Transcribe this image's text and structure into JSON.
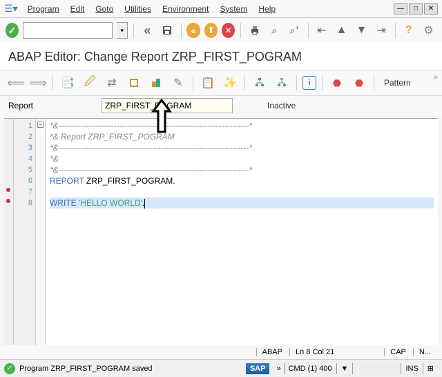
{
  "menu": {
    "program": "Program",
    "edit": "Edit",
    "goto": "Goto",
    "utilities": "Utilities",
    "environment": "Environment",
    "system": "System",
    "help": "Help"
  },
  "title": "ABAP Editor: Change Report ZRP_FIRST_POGRAM",
  "toolbar2": {
    "pattern": "Pattern"
  },
  "reportbar": {
    "label": "Report",
    "value": "ZRP_FIRST_POGRAM",
    "status": "Inactive"
  },
  "code": {
    "l1": "*&---------------------------------------------------------------------*",
    "l2": "*& Report ZRP_FIRST_POGRAM",
    "l3": "*&---------------------------------------------------------------------*",
    "l4": "*&",
    "l5": "*&---------------------------------------------------------------------*",
    "l6a": "REPORT",
    "l6b": " ZRP_FIRST_POGRAM.",
    "l8a": "WRITE",
    "l8b": " ",
    "l8c": "'HELLO WORLD'",
    "l8d": "."
  },
  "bottombar": {
    "lang": "ABAP",
    "pos": "Ln    8 Col  21",
    "cap": "CAP",
    "num": "N..."
  },
  "statusbar": {
    "msg": "Program ZRP_FIRST_POGRAM saved",
    "sap": "SAP",
    "raquo": "»",
    "cmd": "CMD (1) 400",
    "ins": "INS"
  }
}
